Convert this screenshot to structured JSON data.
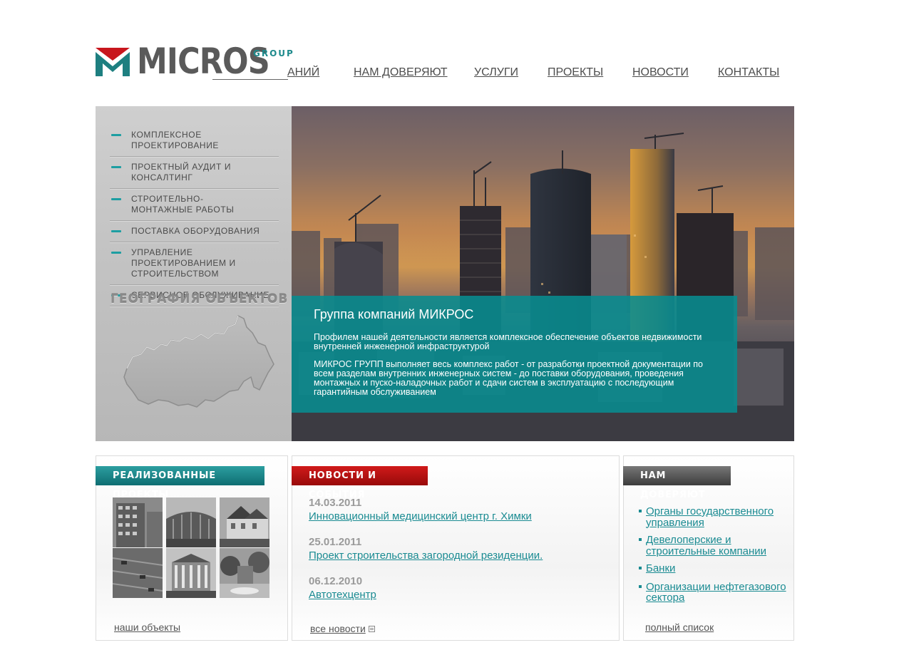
{
  "brand": {
    "name": "MICROS",
    "group": "GROUP",
    "colors": {
      "teal": "#1e8a8c",
      "red": "#c8161d",
      "grey": "#5a5a5a"
    }
  },
  "nav": {
    "items": [
      {
        "label": "АНИЙ"
      },
      {
        "label": "НАМ ДОВЕРЯЮТ"
      },
      {
        "label": "УСЛУГИ"
      },
      {
        "label": "ПРОЕКТЫ"
      },
      {
        "label": "НОВОСТИ"
      },
      {
        "label": "КОНТАКТЫ"
      }
    ]
  },
  "services": {
    "items": [
      {
        "label": "КОМПЛЕКСНОЕ ПРОЕКТИРОВАНИЕ"
      },
      {
        "label": "ПРОЕКТНЫЙ АУДИТ И КОНСАЛТИНГ"
      },
      {
        "label": "СТРОИТЕЛЬНО-МОНТАЖНЫЕ РАБОТЫ"
      },
      {
        "label": "ПОСТАВКА ОБОРУДОВАНИЯ"
      },
      {
        "label": "УПРАВЛЕНИЕ ПРОЕКТИРОВАНИЕМ И СТРОИТЕЛЬСТВОМ"
      },
      {
        "label": "СЕРВИСНОЕ ОБСЛУЖИВАНИЕ"
      }
    ],
    "geo_title": "ГЕОГРАФИЯ ОБЪЕКТОВ"
  },
  "hero": {
    "title": "Группа компаний МИКРОС",
    "p1": "Профилем нашей деятельности является комплексное обеспечение объектов недвижимости внутренней инженерной инфраструктурой",
    "p2": "МИКРОС ГРУПП выполняет весь комплекс работ - от разработки проектной документации по всем разделам внутренних инженерных систем - до поставки оборудования, проведения монтажных и пуско-наладочных работ и сдачи систем в эксплуатацию с последующим гарантийным обслуживанием"
  },
  "projects": {
    "title": "РЕАЛИЗОВАННЫЕ ПРОЕКТЫ",
    "more": "наши объекты"
  },
  "news": {
    "title": "НОВОСТИ И СОБЫТИЯ",
    "items": [
      {
        "date": "14.03.2011",
        "text": "Инновационный медицинский центр  г. Химки"
      },
      {
        "date": "25.01.2011",
        "text": "Проект строительства загородной резиденции."
      },
      {
        "date": "06.12.2010",
        "text": "Автотехцентр"
      }
    ],
    "more": "все новости"
  },
  "trust": {
    "title": "НАМ ДОВЕРЯЮТ",
    "items": [
      {
        "text": "Органы государственного управления"
      },
      {
        "text": "Девелоперские и строительные компании"
      },
      {
        "text": "Банки"
      },
      {
        "text": "Организации нефтегазового сектора"
      }
    ],
    "more": "полный список"
  }
}
